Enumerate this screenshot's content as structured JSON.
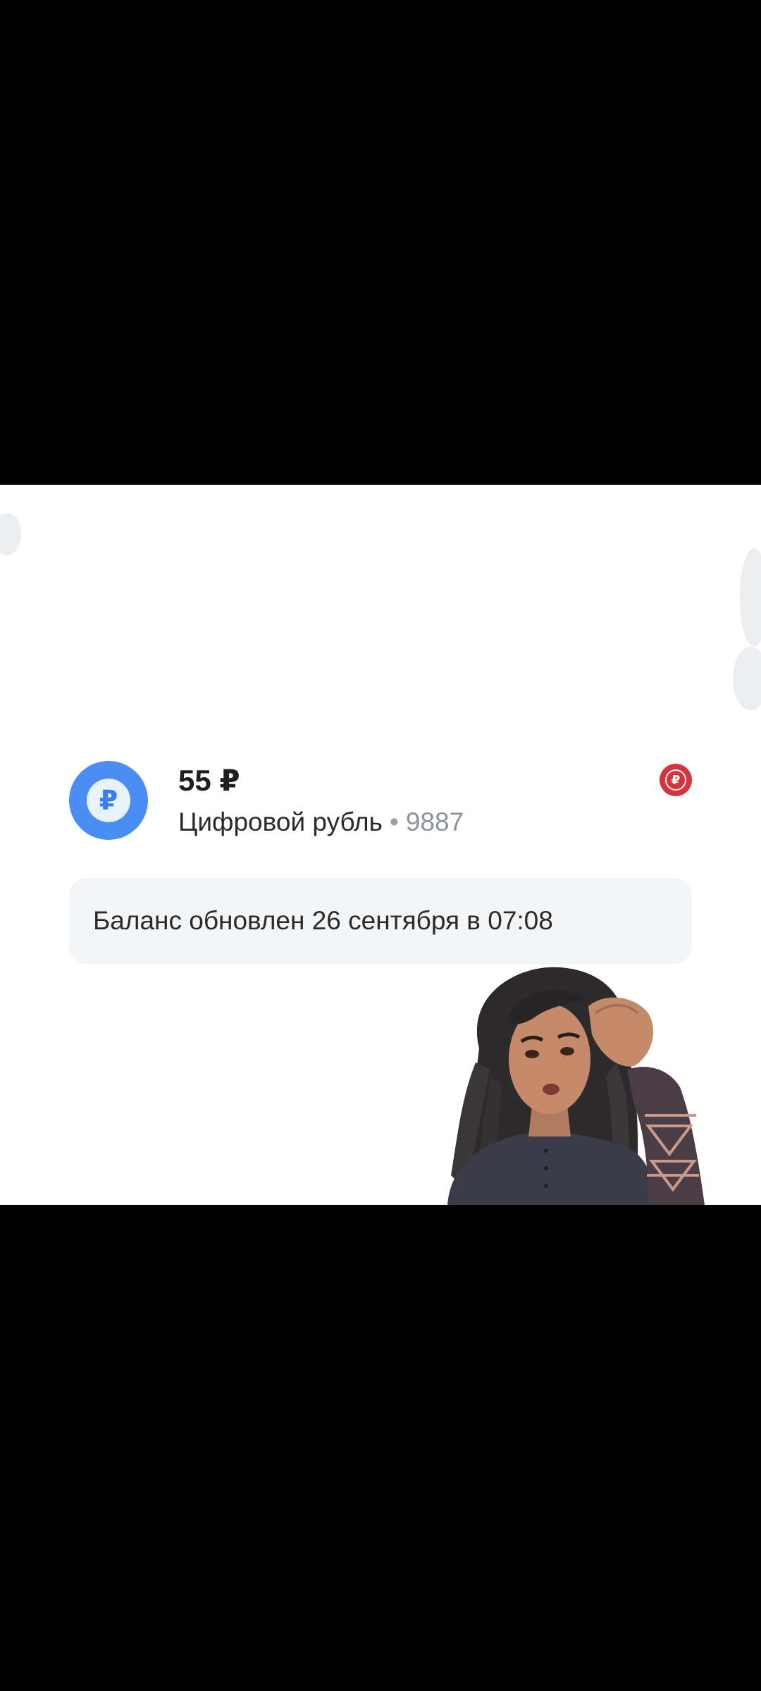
{
  "account": {
    "amount": "55 ₽",
    "icon": "ruble-icon",
    "name": "Цифровой рубль",
    "separator": "•",
    "number": "9887",
    "badge_icon": "ruble-badge-icon"
  },
  "balance_note": {
    "text": "Баланс обновлен 26 сентября в 07:08"
  },
  "colors": {
    "background": "#000000",
    "card": "#ffffff",
    "accent": "#4a8ef5",
    "badge": "#d9323c",
    "note_bg": "#f4f5f6"
  },
  "sticker": {
    "icon": "confused-girl-sticker"
  }
}
